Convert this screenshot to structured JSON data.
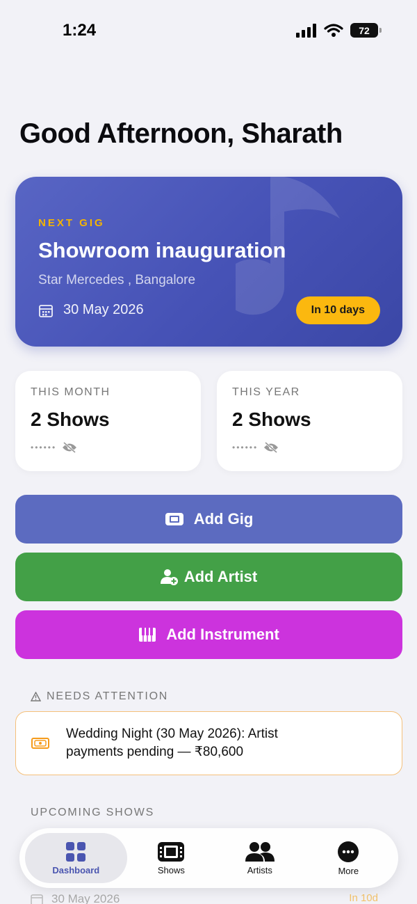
{
  "status_bar": {
    "time": "1:24",
    "battery": "72"
  },
  "greeting": "Good Afternoon, Sharath",
  "next_gig": {
    "label": "NEXT GIG",
    "title": "Showroom inauguration",
    "venue": "Star Mercedes , Bangalore",
    "date": "30 May 2026",
    "badge": "In 10 days"
  },
  "stats": {
    "month": {
      "label": "THIS MONTH",
      "value": "2 Shows",
      "hidden": "••••••"
    },
    "year": {
      "label": "THIS YEAR",
      "value": "2 Shows",
      "hidden": "••••••"
    }
  },
  "actions": {
    "add_gig": "Add Gig",
    "add_artist": "Add Artist",
    "add_instrument": "Add Instrument"
  },
  "attention": {
    "title": "NEEDS ATTENTION",
    "message": "Wedding Night (30 May 2026): Artist payments pending — ₹80,600"
  },
  "upcoming": {
    "title": "UPCOMING SHOWS",
    "peek_date": "30 May 2026",
    "peek_badge": "In 10d"
  },
  "tabs": [
    {
      "label": "Dashboard"
    },
    {
      "label": "Shows"
    },
    {
      "label": "Artists"
    },
    {
      "label": "More"
    }
  ],
  "colors": {
    "gig_card": "#4652b6",
    "accent_yellow": "#fbb80f",
    "add_gig": "#5c6bc0",
    "add_artist": "#43a047",
    "add_instrument": "#cc33dd",
    "attention_border": "#f5c07a"
  }
}
